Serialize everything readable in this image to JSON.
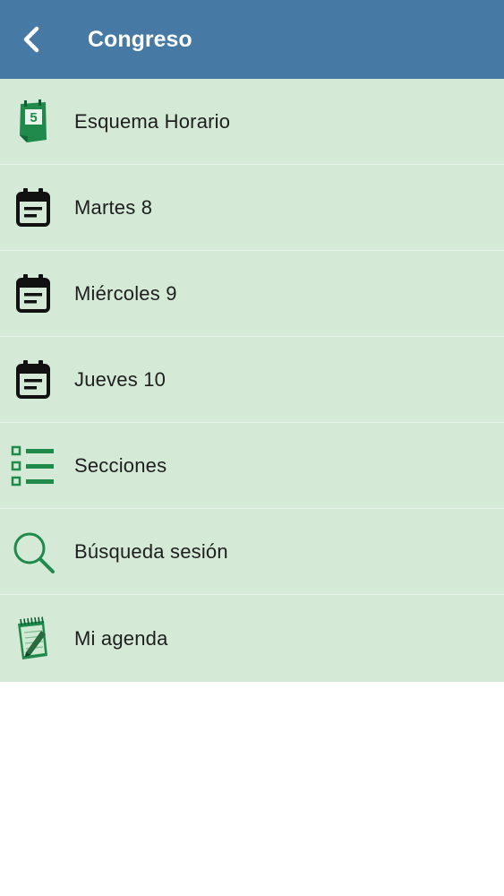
{
  "app_bar": {
    "title": "Congreso",
    "back_icon": "chevron-left-icon",
    "color": "#4679a3"
  },
  "menu": {
    "background": "#d4ead7",
    "items": [
      {
        "label": "Esquema Horario",
        "icon": "calendar-5-icon"
      },
      {
        "label": "Martes 8",
        "icon": "event-note-icon"
      },
      {
        "label": "Miércoles 9",
        "icon": "event-note-icon"
      },
      {
        "label": "Jueves 10",
        "icon": "event-note-icon"
      },
      {
        "label": "Secciones",
        "icon": "checklist-icon"
      },
      {
        "label": "Búsqueda sesión",
        "icon": "search-icon"
      },
      {
        "label": "Mi agenda",
        "icon": "notepad-pencil-icon"
      }
    ],
    "calendar_day": "5"
  }
}
